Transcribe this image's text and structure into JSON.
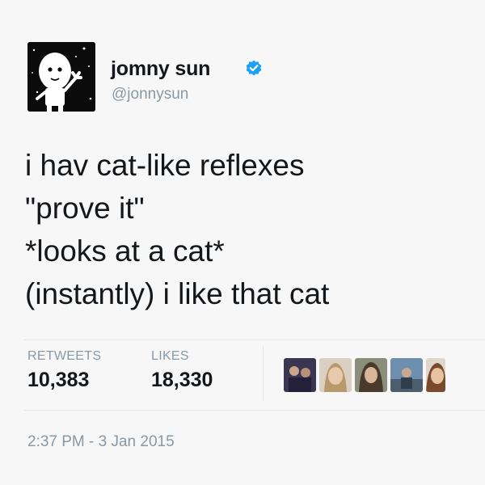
{
  "user": {
    "display_name": "jomny sun",
    "handle": "@jonnysun",
    "verified": true,
    "avatar_icon": "cartoon-alien-avatar"
  },
  "tweet": {
    "lines": [
      "i hav cat-like reflexes",
      "\"prove it\"",
      "*looks at a cat*",
      "(instantly) i like that cat"
    ]
  },
  "stats": {
    "retweets_label": "RETWEETS",
    "retweets_value": "10,383",
    "likes_label": "LIKES",
    "likes_value": "18,330"
  },
  "timestamp": "2:37 PM - 3 Jan 2015",
  "colors": {
    "verified_blue": "#1da1f2",
    "secondary_text": "#8899a6",
    "primary_text": "#14171a"
  }
}
